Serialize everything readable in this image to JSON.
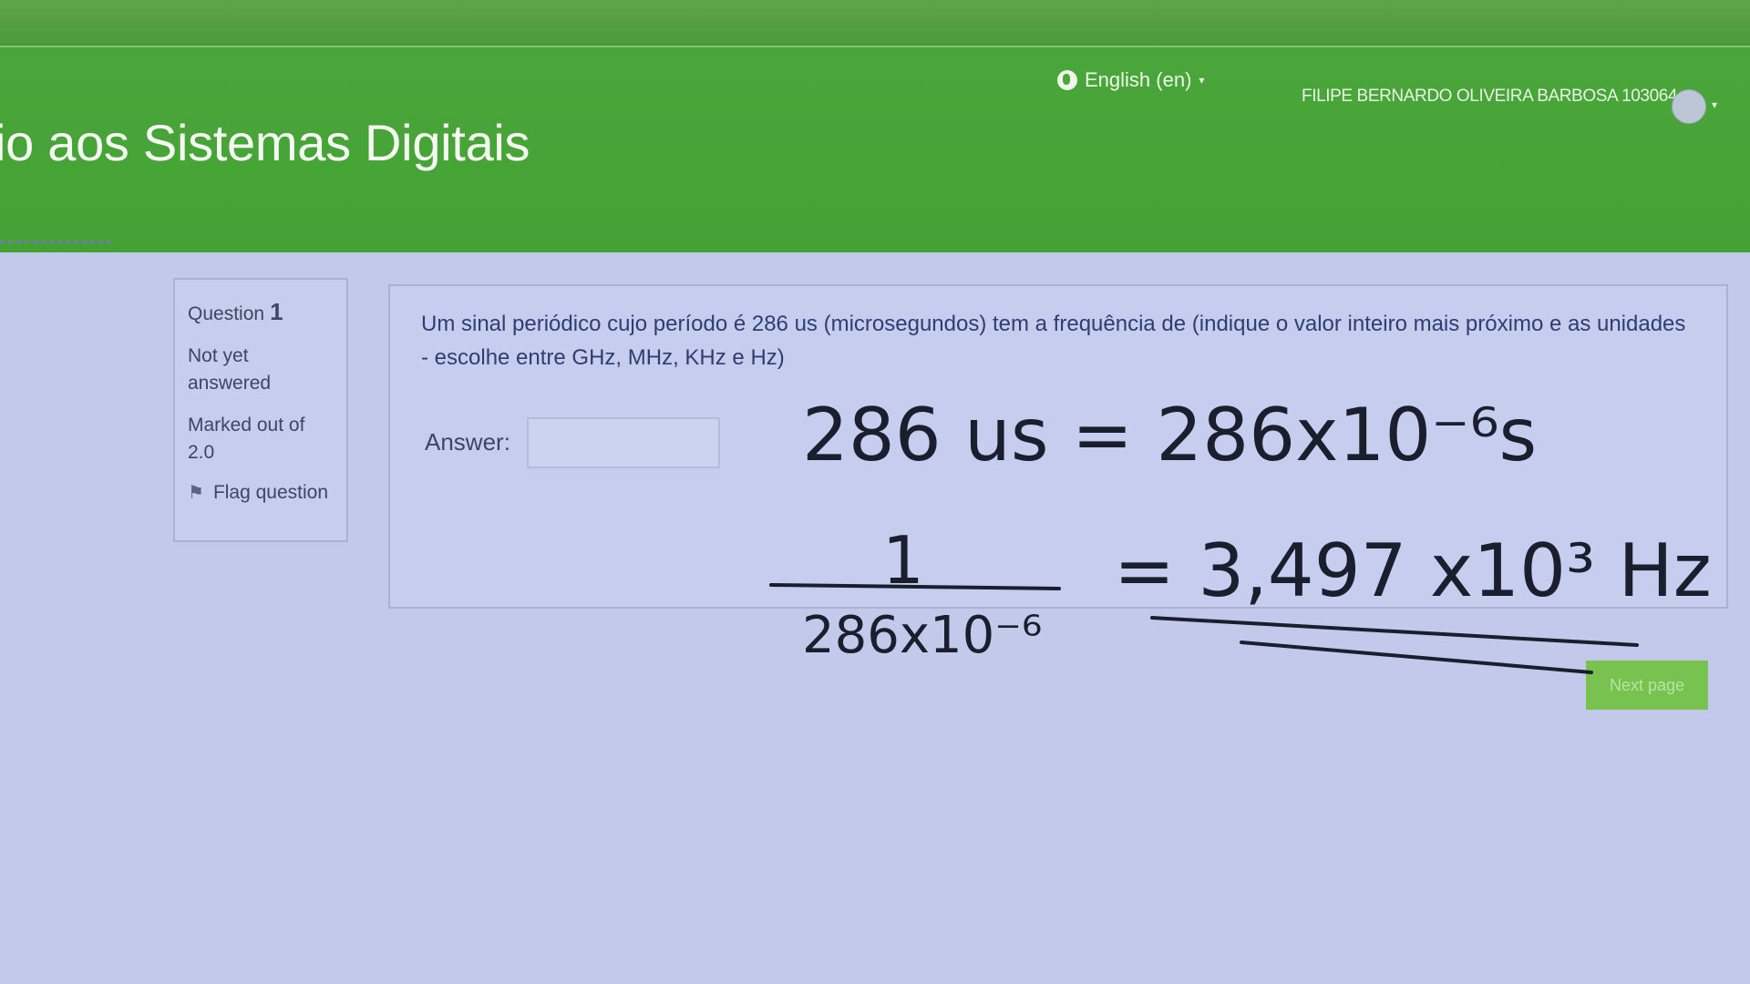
{
  "window": {
    "minimize_icon": "minus-icon",
    "restore_icon": "restore-icon",
    "close_icon": "close-icon"
  },
  "header": {
    "course_title": "io aos Sistemas Digitais",
    "language": "English (en)",
    "language_icon": "globe-icon",
    "user_name": "FILIPE BERNARDO OLIVEIRA BARBOSA 103064"
  },
  "info": {
    "question_label": "Question",
    "question_number": "1",
    "state": "Not yet answered",
    "marked_out_of": "Marked out of 2.0",
    "flag_label": "Flag question"
  },
  "question": {
    "text": "Um sinal periódico cujo período é 286 us (microsegundos) tem a frequência de (indique o valor inteiro mais próximo e as unidades - escolhe entre GHz, MHz, KHz e Hz)",
    "answer_label": "Answer:",
    "answer_value": ""
  },
  "navigation": {
    "next_label": "Next page"
  },
  "handwritten_notes": {
    "line1": "286 us = 286x10⁻⁶s",
    "fraction_numerator": "1",
    "fraction_denominator": "286x10⁻⁶",
    "result": "= 3,497 x10³ Hz"
  }
}
